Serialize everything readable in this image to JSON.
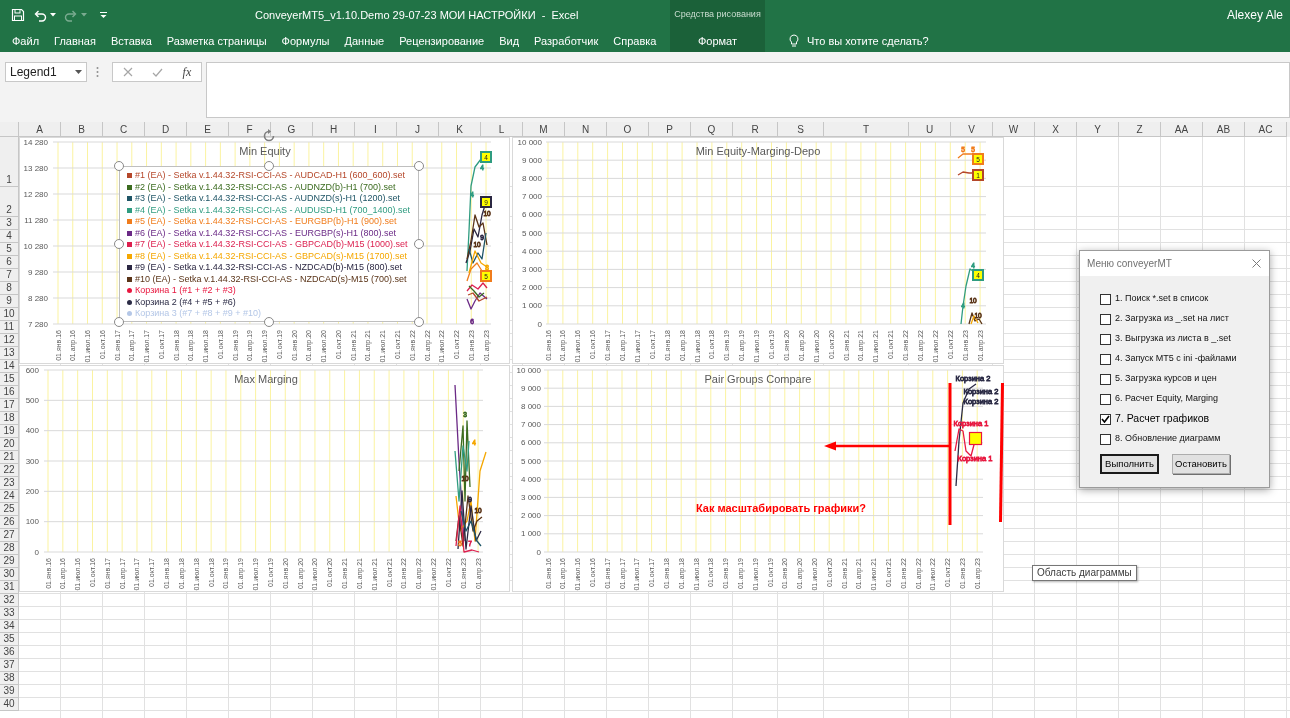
{
  "title_bar": {
    "title": "ConveyerMT5_v1.10.Demo 29-07-23 МОИ НАСТРОЙКИ  -  Excel",
    "user": "Alexey Ale"
  },
  "quick_access": [
    {
      "kind": "save",
      "disabled": false
    },
    {
      "kind": "undo",
      "disabled": false
    },
    {
      "kind": "redo",
      "disabled": true
    },
    {
      "kind": "customize",
      "disabled": false
    }
  ],
  "ribbon": {
    "tabs": [
      {
        "label": "Файл",
        "selected": false
      },
      {
        "label": "Главная",
        "selected": false
      },
      {
        "label": "Вставка",
        "selected": false
      },
      {
        "label": "Разметка страницы",
        "selected": false
      },
      {
        "label": "Формулы",
        "selected": false
      },
      {
        "label": "Данные",
        "selected": false
      },
      {
        "label": "Рецензирование",
        "selected": false
      },
      {
        "label": "Вид",
        "selected": false
      },
      {
        "label": "Разработчик",
        "selected": false
      },
      {
        "label": "Справка",
        "selected": false
      }
    ],
    "context_tab": {
      "group": "Средства рисования",
      "label": "Формат",
      "selected": false
    },
    "tell_me": "Что вы хотите сделать?"
  },
  "formula_bar": {
    "name_box": "Legend1",
    "function_label": "fx"
  },
  "columns": [
    "A",
    "B",
    "C",
    "D",
    "E",
    "F",
    "G",
    "H",
    "I",
    "J",
    "K",
    "L",
    "M",
    "N",
    "O",
    "P",
    "Q",
    "R",
    "S",
    "T",
    "U",
    "V",
    "W",
    "X",
    "Y",
    "Z",
    "AA",
    "AB",
    "AC"
  ],
  "rows": [
    "1",
    "2",
    "3",
    "4",
    "5",
    "6",
    "7",
    "8",
    "9",
    "10",
    "11",
    "12",
    "13",
    "14",
    "15",
    "16",
    "17",
    "18",
    "19",
    "20",
    "21",
    "22",
    "23",
    "24",
    "25",
    "26",
    "27",
    "28",
    "29",
    "30",
    "31",
    "32",
    "33",
    "34",
    "35",
    "36",
    "37",
    "38",
    "39",
    "40"
  ],
  "charts": [
    {
      "title": "Min Equity",
      "y_axis_labels": [
        "14 280",
        "13 280",
        "12 280",
        "11 280",
        "10 280",
        "9 280",
        "8 280",
        "7 280"
      ],
      "x_axis_labels": [
        "01.янв.16",
        "01.апр.16",
        "01.июл.16",
        "01.окт.16",
        "01.янв.17",
        "01.апр.17",
        "01.июл.17",
        "01.окт.17",
        "01.янв.18",
        "01.апр.18",
        "01.июл.18",
        "01.окт.18",
        "01.янв.19",
        "01.апр.19",
        "01.июл.19",
        "01.окт.19",
        "01.янв.20",
        "01.апр.20",
        "01.июл.20",
        "01.окт.20",
        "01.янв.21",
        "01.апр.21",
        "01.июл.21",
        "01.окт.21",
        "01.янв.22",
        "01.апр.22",
        "01.июл.22",
        "01.окт.22",
        "01.янв.23",
        "01.апр.23"
      ],
      "legend": {
        "selected": true,
        "items": [
          {
            "label": "#1 (EA) - Setka v.1.44.32-RSI-CCI-AS - AUDCAD-H1 (600_600).set",
            "kind": "square",
            "color": "#b5472a"
          },
          {
            "label": "#2 (EA) - Setka v.1.44.32-RSI-CCI-AS - AUDNZD(b)-H1 (700).set",
            "kind": "square",
            "color": "#3b6b1f"
          },
          {
            "label": "#3 (EA) - Setka v.1.44.32-RSI-CCI-AS - AUDNZD(s)-H1 (1200).set",
            "kind": "square",
            "color": "#1f5566"
          },
          {
            "label": "#4 (EA) - Setka v.1.44.32-RSI-CCI-AS - AUDUSD-H1 (700_1400).set",
            "kind": "square",
            "color": "#2f9c80"
          },
          {
            "label": "#5 (EA) - Setka v.1.44.32-RSI-CCI-AS - EURGBP(b)-H1 (900).set",
            "kind": "square",
            "color": "#f07c1c"
          },
          {
            "label": "#6 (EA) - Setka v.1.44.32-RSI-CCI-AS - EURGBP(s)-H1 (800).set",
            "kind": "square",
            "color": "#6b2a86"
          },
          {
            "label": "#7 (EA) - Setka v.1.44.32-RSI-CCI-AS - GBPCAD(b)-M15 (1000).set",
            "kind": "square",
            "color": "#dc1f4e"
          },
          {
            "label": "#8 (EA) - Setka v.1.44.32-RSI-CCI-AS - GBPCAD(s)-M15 (1700).set",
            "kind": "square",
            "color": "#f5a700"
          },
          {
            "label": "#9 (EA) - Setka v.1.44.32-RSI-CCI-AS - NZDCAD(b)-M15 (800).set",
            "kind": "square",
            "color": "#2b2742"
          },
          {
            "label": "#10 (EA) - Setka v.1.44.32-RSI-CCI-AS - NZDCAD(s)-M15 (700).set",
            "kind": "square",
            "color": "#5a3418"
          },
          {
            "label": "Корзина 1 (#1 + #2 + #3)",
            "kind": "circle",
            "color": "#e8173f"
          },
          {
            "label": "Корзина 2 (#4 + #5 + #6)",
            "kind": "circle",
            "color": "#2b2b45"
          },
          {
            "label": "Корзина 3 (#7 + #8 + #9 + #10)",
            "kind": "circle",
            "color": "#b4c7e7"
          }
        ]
      },
      "data_labels": [
        {
          "text": "4",
          "kind": "boxed",
          "color": "#2f9c80"
        },
        {
          "text": "4",
          "kind": "plain",
          "color": "#2f9c80"
        },
        {
          "text": "4",
          "kind": "plain",
          "color": "#2f9c80"
        },
        {
          "text": "9",
          "kind": "boxed",
          "color": "#2b2742"
        },
        {
          "text": "10",
          "kind": "plain",
          "color": "#5a3418"
        },
        {
          "text": "9",
          "kind": "plain",
          "color": "#2b2742"
        },
        {
          "text": "10",
          "kind": "plain",
          "color": "#5a3418"
        },
        {
          "text": "8",
          "kind": "plain",
          "color": "#f5a700"
        },
        {
          "text": "5",
          "kind": "boxed",
          "color": "#f07c1c"
        },
        {
          "text": "6",
          "kind": "plain",
          "color": "#6b2a86"
        }
      ]
    },
    {
      "title": "Min Equity-Marging-Depo",
      "y_axis_labels": [
        "10 000",
        "9 000",
        "8 000",
        "7 000",
        "6 000",
        "5 000",
        "4 000",
        "3 000",
        "2 000",
        "1 000",
        "0"
      ],
      "x_axis_labels": [
        "01.янв.16",
        "01.апр.16",
        "01.июл.16",
        "01.окт.16",
        "01.янв.17",
        "01.апр.17",
        "01.июл.17",
        "01.окт.17",
        "01.янв.18",
        "01.апр.18",
        "01.июл.18",
        "01.окт.18",
        "01.янв.19",
        "01.апр.19",
        "01.июл.19",
        "01.окт.19",
        "01.янв.20",
        "01.апр.20",
        "01.июл.20",
        "01.окт.20",
        "01.янв.21",
        "01.апр.21",
        "01.июл.21",
        "01.окт.21",
        "01.янв.22",
        "01.апр.22",
        "01.июл.22",
        "01.окт.22",
        "01.янв.23",
        "01.апр.23"
      ],
      "data_labels": [
        {
          "text": "5",
          "kind": "plain",
          "color": "#f07c1c"
        },
        {
          "text": "5",
          "kind": "plain",
          "color": "#f07c1c"
        },
        {
          "text": "5",
          "kind": "boxed",
          "color": "#f07c1c"
        },
        {
          "text": "1",
          "kind": "boxed",
          "color": "#b5472a"
        },
        {
          "text": "4",
          "kind": "plain",
          "color": "#2f9c80"
        },
        {
          "text": "4",
          "kind": "boxed",
          "color": "#2f9c80"
        },
        {
          "text": "10",
          "kind": "plain",
          "color": "#5a3418"
        },
        {
          "text": "4",
          "kind": "plain",
          "color": "#2f9c80"
        },
        {
          "text": "10",
          "kind": "plain",
          "color": "#5a3418"
        }
      ]
    },
    {
      "title": "Max Marging",
      "y_axis_labels": [
        "600",
        "500",
        "400",
        "300",
        "200",
        "100",
        "0"
      ],
      "x_axis_labels": [
        "01.янв.16",
        "01.апр.16",
        "01.июл.16",
        "01.окт.16",
        "01.янв.17",
        "01.апр.17",
        "01.июл.17",
        "01.окт.17",
        "01.янв.18",
        "01.апр.18",
        "01.июл.18",
        "01.окт.18",
        "01.янв.19",
        "01.апр.19",
        "01.июл.19",
        "01.окт.19",
        "01.янв.20",
        "01.апр.20",
        "01.июл.20",
        "01.окт.20",
        "01.янв.21",
        "01.апр.21",
        "01.июл.21",
        "01.окт.21",
        "01.янв.22",
        "01.апр.22",
        "01.июл.22",
        "01.окт.22",
        "01.янв.23",
        "01.апр.23"
      ],
      "data_labels": [
        {
          "text": "3",
          "kind": "plain",
          "color": "#3b6b1f"
        },
        {
          "text": "4",
          "kind": "plain",
          "color": "#f5a700"
        },
        {
          "text": "10",
          "kind": "plain",
          "color": "#5a3418"
        },
        {
          "text": "9",
          "kind": "plain",
          "color": "#2b2742"
        },
        {
          "text": "10",
          "kind": "plain",
          "color": "#5a3418"
        },
        {
          "text": "5",
          "kind": "plain",
          "color": "#f07c1c"
        },
        {
          "text": "7",
          "kind": "plain",
          "color": "#dc1f4e"
        }
      ]
    },
    {
      "title": "Pair Groups Compare",
      "y_axis_labels": [
        "10 000",
        "9 000",
        "8 000",
        "7 000",
        "6 000",
        "5 000",
        "4 000",
        "3 000",
        "2 000",
        "1 000",
        "0"
      ],
      "x_axis_labels": [
        "01.янв.16",
        "01.апр.16",
        "01.июл.16",
        "01.окт.16",
        "01.янв.17",
        "01.апр.17",
        "01.июл.17",
        "01.окт.17",
        "01.янв.18",
        "01.апр.18",
        "01.июл.18",
        "01.окт.18",
        "01.янв.19",
        "01.апр.19",
        "01.июл.19",
        "01.окт.19",
        "01.янв.20",
        "01.апр.20",
        "01.июл.20",
        "01.окт.20",
        "01.янв.21",
        "01.апр.21",
        "01.июл.21",
        "01.окт.21",
        "01.янв.22",
        "01.апр.22",
        "01.июл.22",
        "01.окт.22",
        "01.янв.23",
        "01.апр.23"
      ],
      "data_labels": [
        {
          "text": "Корзина 2",
          "kind": "plain",
          "color": "#2b2b45"
        },
        {
          "text": "Корзина 2",
          "kind": "plain",
          "color": "#2b2b45"
        },
        {
          "text": "Корзина 2",
          "kind": "plain",
          "color": "#2b2b45"
        },
        {
          "text": "Корзина 1",
          "kind": "plain",
          "color": "#e8173f"
        },
        {
          "text": "Корзина 1",
          "kind": "plain",
          "color": "#e8173f"
        }
      ],
      "note": "Как масштабировать графики?"
    }
  ],
  "dialog": {
    "title": "Меню conveyerMT",
    "options": [
      {
        "label": "1. Поиск *.set в список",
        "checked": false
      },
      {
        "label": "2. Загрузка из _.set на лист",
        "checked": false
      },
      {
        "label": "3. Выгрузка из листа в _.set",
        "checked": false
      },
      {
        "label": "4. Запуск MT5 с ini -файлами",
        "checked": false
      },
      {
        "label": "5. Загрузка курсов и цен",
        "checked": false
      },
      {
        "label": "6. Расчет Equity, Marging",
        "checked": false
      },
      {
        "label": "7. Расчет графиков",
        "checked": true
      },
      {
        "label": "8. Обновление диаграмм",
        "checked": false
      }
    ],
    "buttons": [
      {
        "label": "Выполнить",
        "default": true
      },
      {
        "label": "Остановить",
        "default": false
      }
    ]
  },
  "tooltip": "Область диаграммы"
}
